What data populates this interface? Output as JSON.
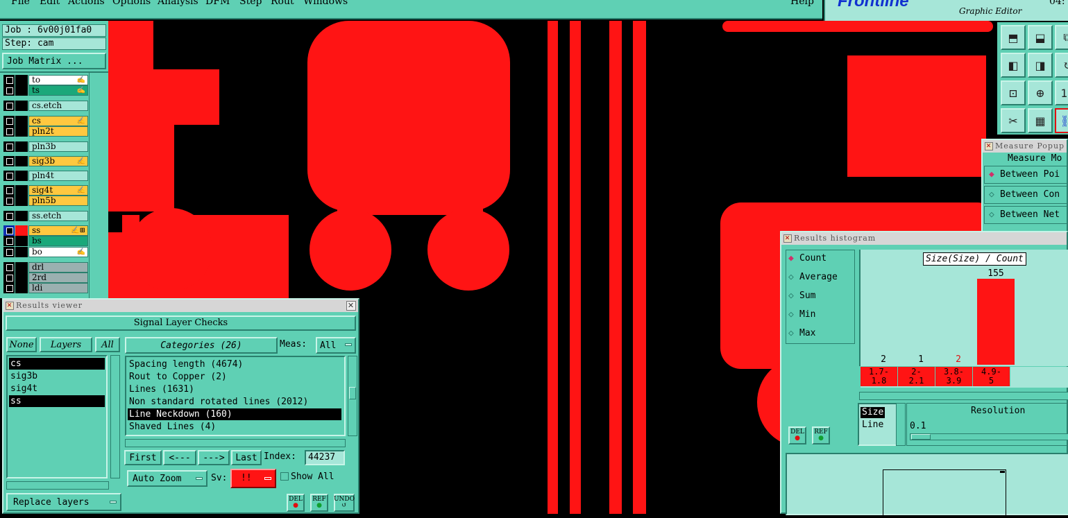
{
  "menubar": {
    "items": [
      "File",
      "Edit",
      "Actions",
      "Options",
      "Analysis",
      "DFM",
      "Step",
      "Rout",
      "Windows"
    ],
    "help": "Help"
  },
  "logo": {
    "brand": "Frontline",
    "subtitle": "Graphic Editor",
    "clock": "04:"
  },
  "job": {
    "job": "Job : 6v00j01fa0",
    "step": "Step: cam",
    "matrix_button": "Job Matrix ..."
  },
  "layers": [
    {
      "name": "to",
      "color": "#ffffff",
      "mark": "✍"
    },
    {
      "name": "ts",
      "color": "#1aa87a",
      "mark": "✍"
    },
    {
      "name": "cs.etch",
      "color": "#a6e6d8",
      "mark": ""
    },
    {
      "name": "cs",
      "color": "#ffc840",
      "mark": "✍"
    },
    {
      "name": "pln2t",
      "color": "#ffc840",
      "mark": ""
    },
    {
      "name": "pln3b",
      "color": "#a6e6d8",
      "mark": ""
    },
    {
      "name": "sig3b",
      "color": "#ffc840",
      "mark": "✍"
    },
    {
      "name": "pln4t",
      "color": "#a6e6d8",
      "mark": ""
    },
    {
      "name": "sig4t",
      "color": "#ffc840",
      "mark": "✍"
    },
    {
      "name": "pln5b",
      "color": "#ffc840",
      "mark": ""
    },
    {
      "name": "ss.etch",
      "color": "#a6e6d8",
      "mark": ""
    },
    {
      "name": "ss",
      "color": "#ffc840",
      "mark": "✍⊞"
    },
    {
      "name": "bs",
      "color": "#1aa87a",
      "mark": ""
    },
    {
      "name": "bo",
      "color": "#ffffff",
      "mark": "✍"
    },
    {
      "name": "drl",
      "color": "#9ab0b0",
      "mark": ""
    },
    {
      "name": "2rd",
      "color": "#9ab0b0",
      "mark": ""
    },
    {
      "name": "ldi",
      "color": "#9ab0b0",
      "mark": ""
    }
  ],
  "results_viewer": {
    "title": "Results viewer",
    "header": "Signal Layer Checks",
    "none_btn": "None",
    "layers_btn": "Layers",
    "all_btn": "All",
    "layer_list": [
      {
        "name": "cs",
        "selected": true
      },
      {
        "name": "sig3b",
        "selected": false
      },
      {
        "name": "sig4t",
        "selected": false
      },
      {
        "name": "ss",
        "selected": true
      }
    ],
    "categories_btn": "Categories (26)",
    "meas_label": "Meas:",
    "meas_value": "All",
    "categories": [
      {
        "name": "Spacing length (4674)",
        "selected": false
      },
      {
        "name": "Rout to Copper (2)",
        "selected": false
      },
      {
        "name": "Lines (1631)",
        "selected": false
      },
      {
        "name": "Non standard rotated lines (2012)",
        "selected": false
      },
      {
        "name": "Line Neckdown (160)",
        "selected": true
      },
      {
        "name": "Shaved Lines (4)",
        "selected": false
      }
    ],
    "first": "First",
    "prev": "<---",
    "next": "--->",
    "last": "Last",
    "index_label": "Index:",
    "index_value": "44237",
    "zoom": "Auto Zoom",
    "sv_label": "Sv:",
    "sv_value": "!!",
    "show_all": "Show All",
    "replace_layers": "Replace layers",
    "del": "DEL",
    "ref": "REF",
    "undo": "UNDO"
  },
  "histogram": {
    "title": "Results histogram",
    "modes": [
      {
        "label": "Count",
        "on": true
      },
      {
        "label": "Average",
        "on": false
      },
      {
        "label": "Sum",
        "on": false
      },
      {
        "label": "Min",
        "on": false
      },
      {
        "label": "Max",
        "on": false
      }
    ],
    "chart_title": "Size(Size) / Count",
    "bins": [
      {
        "label_top": "1.7-",
        "label_bottom": "1.8",
        "count": 2,
        "count_color": "#000000"
      },
      {
        "label_top": "2-",
        "label_bottom": "2.1",
        "count": 1,
        "count_color": "#000000"
      },
      {
        "label_top": "3.8-",
        "label_bottom": "3.9",
        "count": 2,
        "count_color": "#e01010"
      },
      {
        "label_top": "4.9-",
        "label_bottom": "5",
        "count": 155,
        "count_color": "#000000"
      }
    ],
    "size_items": [
      "Size",
      "Line"
    ],
    "resolution_label": "Resolution",
    "resolution_value": "0.1",
    "del": "DEL",
    "ref": "REF"
  },
  "measure_popup": {
    "title": "Measure Popup",
    "header": "Measure Mo",
    "options": [
      {
        "label": "Between Poi",
        "on": true
      },
      {
        "label": "Between Con",
        "on": false
      },
      {
        "label": "Between Net",
        "on": false
      }
    ]
  },
  "tools": {
    "icons": [
      "zoom-home-icon",
      "zoom-in-icon",
      "zoom-window-icon",
      "pan-left-icon",
      "pan-right-icon",
      "redraw-icon",
      "fit-screen-icon",
      "center-icon",
      "ratio-icon",
      "snap-tool-icon",
      "grid-icon",
      "net-icon"
    ],
    "ratio_text": "1:"
  }
}
